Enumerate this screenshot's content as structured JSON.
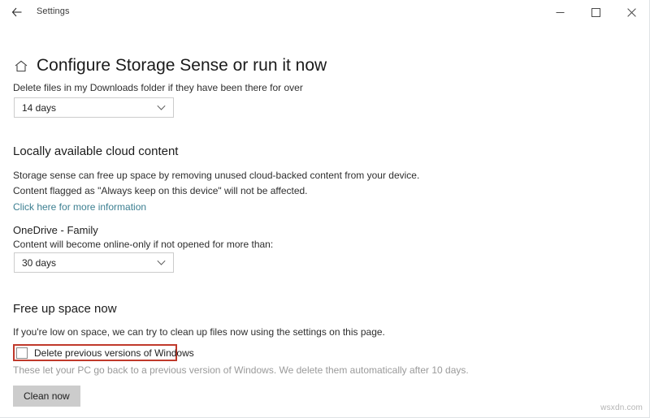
{
  "window": {
    "titlebar": {
      "back_label": "back-arrow",
      "title": "Settings",
      "minimize_label": "Minimize",
      "maximize_label": "Maximize",
      "close_label": "Close"
    }
  },
  "page": {
    "home_icon": "home-icon",
    "title": "Configure Storage Sense or run it now"
  },
  "downloads": {
    "description": "Delete files in my Downloads folder if they have been there for over",
    "dropdown_value": "14 days"
  },
  "cloud": {
    "heading": "Locally available cloud content",
    "line1": "Storage sense can free up space by removing unused cloud-backed content from your device.",
    "line2": "Content flagged as \"Always keep on this device\" will not be affected.",
    "link": "Click here for more information",
    "account": "OneDrive - Family",
    "account_description": "Content will become online-only if not opened for more than:",
    "dropdown_value": "30 days"
  },
  "freeup": {
    "heading": "Free up space now",
    "description": "If you're low on space, we can try to clean up files now using the settings on this page.",
    "checkbox_label": "Delete previous versions of Windows",
    "checkbox_checked": false,
    "checkbox_help": "These let your PC go back to a previous version of Windows. We delete them automatically after 10 days.",
    "clean_button": "Clean now",
    "highlight_color": "#c0392b"
  },
  "watermark": {
    "text": "wsxdn.com"
  }
}
